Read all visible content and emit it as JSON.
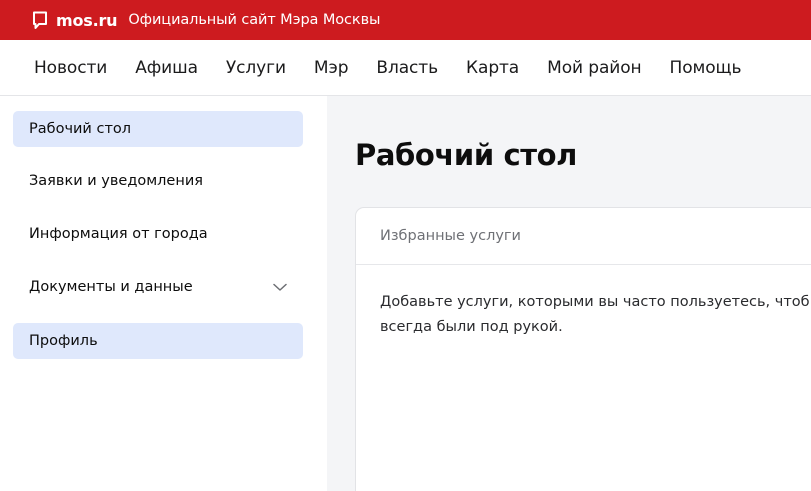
{
  "topbar": {
    "logo_icon": "speech-bubble-icon",
    "logo_text": "mos.ru",
    "site_title": "Официальный сайт Мэра Москвы",
    "background_color": "#cd1b1f"
  },
  "nav": {
    "items": [
      {
        "label": "Новости"
      },
      {
        "label": "Афиша"
      },
      {
        "label": "Услуги"
      },
      {
        "label": "Мэр"
      },
      {
        "label": "Власть"
      },
      {
        "label": "Карта"
      },
      {
        "label": "Мой район"
      },
      {
        "label": "Помощь"
      }
    ]
  },
  "sidebar": {
    "items": [
      {
        "label": "Рабочий стол",
        "active": true
      },
      {
        "label": "Заявки и уведомления",
        "active": false
      },
      {
        "label": "Информация от города",
        "active": false
      },
      {
        "label": "Документы и данные",
        "active": false,
        "icon": "chevron-down-icon"
      },
      {
        "label": "Профиль",
        "active": true
      }
    ],
    "active_color": "#dfe8fc"
  },
  "main": {
    "title": "Рабочий стол",
    "favorites": {
      "header": "Избранные услуги",
      "line1": "Добавьте услуги, которыми вы часто пользуетесь, чтоб",
      "line2": "всегда были под рукой."
    }
  }
}
